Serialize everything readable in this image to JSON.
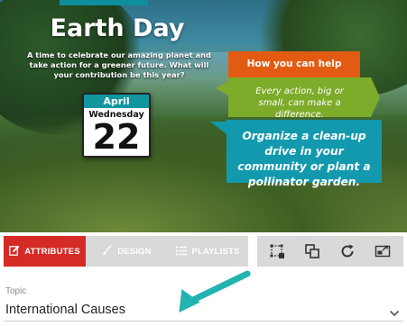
{
  "poster": {
    "title": "Earth Day",
    "tagline": "A time to celebrate our amazing planet and take action for a greener future. What will your contribution be this year?",
    "calendar": {
      "month": "April",
      "weekday": "Wednesday",
      "day": "22"
    },
    "callout_heading": "How you can help",
    "callout_subtext": "Every action, big or small, can make a difference.",
    "callout_action": "Organize a clean-up drive in your community or plant a pollinator garden.",
    "colors": {
      "orange": "#e35b13",
      "green": "#7dab2a",
      "teal": "#1399ad",
      "calendar_header": "#1196a0"
    }
  },
  "toolbar": {
    "tabs": [
      {
        "label": "ATTRIBUTES",
        "icon": "edit-icon",
        "active": true
      },
      {
        "label": "DESIGN",
        "icon": "brush-icon",
        "active": false
      },
      {
        "label": "PLAYLISTS",
        "icon": "list-icon",
        "active": false
      }
    ],
    "tools": [
      "crop-icon",
      "layers-icon",
      "refresh-icon",
      "external-link-icon"
    ],
    "accent": "#d52b27"
  },
  "topic": {
    "label": "Topic",
    "value": "International Causes",
    "arrow_color": "#23b3b1"
  }
}
